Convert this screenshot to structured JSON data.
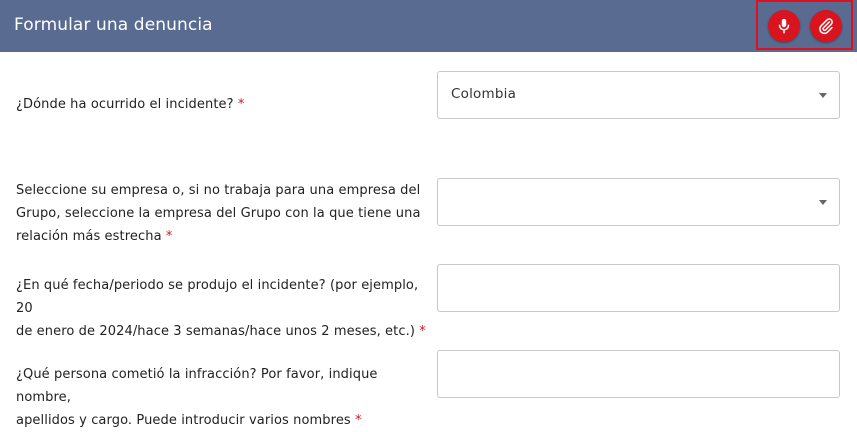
{
  "header": {
    "title": "Formular una denuncia",
    "actions": [
      {
        "name": "microphone",
        "icon": "microphone-icon",
        "color": "#d9141e"
      },
      {
        "name": "attachment",
        "icon": "paperclip-icon",
        "color": "#d9141e"
      }
    ],
    "background": "#5a6b91",
    "highlight_border": "#e0101f"
  },
  "required_marker": "*",
  "form": {
    "rows": [
      {
        "label": "¿Dónde ha ocurrido el incidente?",
        "type": "select",
        "value": "Colombia"
      },
      {
        "label_lines": [
          "Seleccione su empresa o, si no trabaja para una empresa del",
          "Grupo, seleccione la empresa del Grupo con la que tiene una",
          "relación más estrecha"
        ],
        "type": "select",
        "value": ""
      },
      {
        "label_lines": [
          "¿En qué fecha/periodo se produjo el incidente? (por ejemplo, 20",
          "de enero de 2024/hace 3 semanas/hace unos 2 meses, etc.)"
        ],
        "type": "text",
        "value": ""
      },
      {
        "label_lines": [
          "¿Qué persona cometió la infracción? Por favor, indique nombre,",
          "apellidos y cargo. Puede introducir varios nombres"
        ],
        "type": "text",
        "value": ""
      }
    ]
  }
}
